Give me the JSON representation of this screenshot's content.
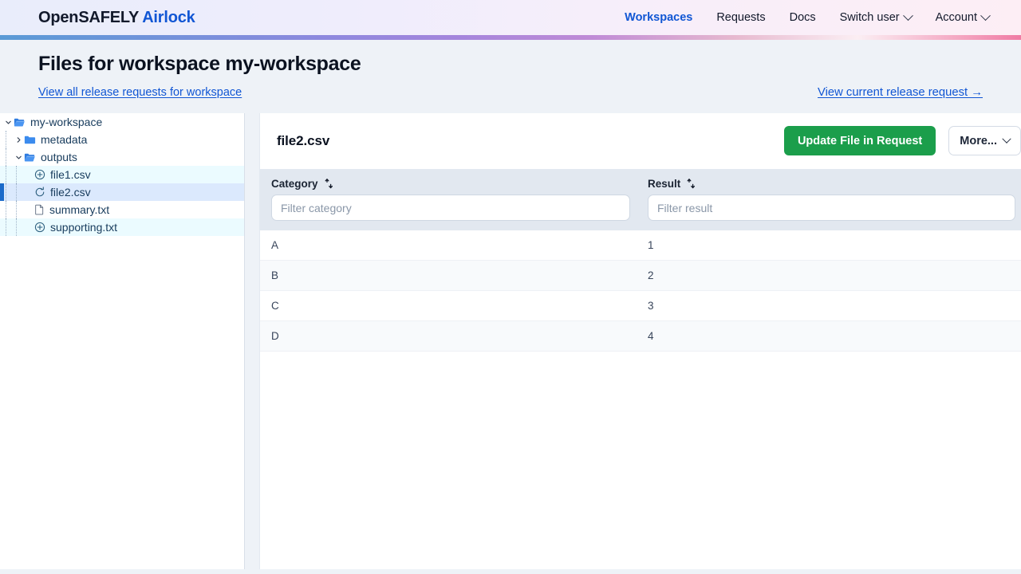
{
  "brand": {
    "primary": "OpenSAFELY",
    "secondary": "Airlock"
  },
  "nav": {
    "items": [
      {
        "label": "Workspaces",
        "active": true,
        "caret": false
      },
      {
        "label": "Requests",
        "active": false,
        "caret": false
      },
      {
        "label": "Docs",
        "active": false,
        "caret": false
      },
      {
        "label": "Switch user",
        "active": false,
        "caret": true
      },
      {
        "label": "Account",
        "active": false,
        "caret": true
      }
    ]
  },
  "page": {
    "title": "Files for workspace my-workspace",
    "workspace_link": "View all release requests for workspace",
    "current_request_link": "View current release request →"
  },
  "tree": {
    "items": [
      {
        "label": "my-workspace",
        "depth": 0,
        "chevron": "down",
        "icon": "folder-open-icon",
        "state": "white"
      },
      {
        "label": "metadata",
        "depth": 1,
        "chevron": "right",
        "icon": "folder-closed-icon",
        "state": "white"
      },
      {
        "label": "outputs",
        "depth": 1,
        "chevron": "down",
        "icon": "folder-open-icon",
        "state": "white"
      },
      {
        "label": "file1.csv",
        "depth": 2,
        "chevron": "none",
        "icon": "plus-circle-icon",
        "state": "tint"
      },
      {
        "label": "file2.csv",
        "depth": 2,
        "chevron": "none",
        "icon": "update-circle-icon",
        "state": "sel"
      },
      {
        "label": "summary.txt",
        "depth": 2,
        "chevron": "none",
        "icon": "file-icon",
        "state": "white"
      },
      {
        "label": "supporting.txt",
        "depth": 2,
        "chevron": "none",
        "icon": "plus-circle-icon",
        "state": "tint"
      }
    ]
  },
  "file_panel": {
    "filename": "file2.csv",
    "primary_action": "Update File in Request",
    "more_action": "More..."
  },
  "table": {
    "columns": [
      {
        "header": "Category",
        "filter_placeholder": "Filter category",
        "filter_value": ""
      },
      {
        "header": "Result",
        "filter_placeholder": "Filter result",
        "filter_value": ""
      }
    ],
    "rows": [
      {
        "category": "A",
        "result": "1"
      },
      {
        "category": "B",
        "result": "2"
      },
      {
        "category": "C",
        "result": "3"
      },
      {
        "category": "D",
        "result": "4"
      }
    ]
  },
  "colors": {
    "brand_blue": "#1156d4",
    "primary_green": "#1b9e4b",
    "selection_blue": "#dbe9fd",
    "accent_bar_blue": "#1b6ac9",
    "table_header": "#e2e8f0",
    "page_bg": "#eef2f7"
  }
}
